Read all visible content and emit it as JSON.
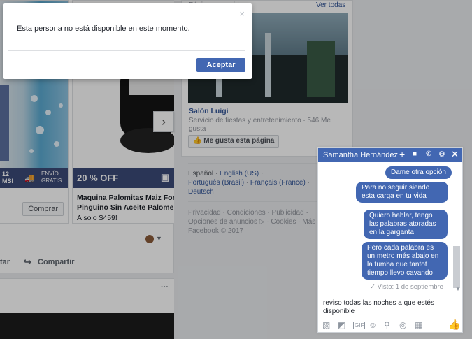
{
  "feed": {
    "products": [
      {
        "badge_left": "12",
        "badge_left_sub": "MSI",
        "badge_right": "ENVÍO",
        "badge_right_sub": "GRATIS",
        "buy_label": "Comprar"
      },
      {
        "discount": "20 % OFF",
        "title_line1": "Maquina Palomitas Maiz Forma",
        "title_line2": "Pingüino Sin Aceite Palomera",
        "price": "A solo $459!"
      }
    ],
    "comment_action": "tar",
    "share_action": "Compartir",
    "more": "···"
  },
  "suggested": {
    "title": "Páginas sugeridas",
    "see_all": "Ver todas",
    "page_name": "Salón Luigi",
    "page_desc_line1": "Servicio de fiestas y entretenimiento · 546 Me",
    "page_desc_line2": "gusta",
    "like_button": "Me gusta esta página"
  },
  "languages": {
    "line1": [
      "Español",
      "English (US)"
    ],
    "line2": [
      "Português (Brasil)",
      "Français (France)"
    ],
    "line3": [
      "Deutsch"
    ]
  },
  "footer": {
    "line1": [
      "Privacidad",
      "Condiciones",
      "Publicidad"
    ],
    "line2": [
      "Opciones de anuncios",
      "Cookies",
      "Más"
    ],
    "copyright": "Facebook © 2017"
  },
  "modal": {
    "message": "Esta persona no está disponible en este momento.",
    "accept_label": "Aceptar",
    "close": "×"
  },
  "chat": {
    "contact_name": "Samantha Hernández",
    "messages": [
      "Dame otra opción",
      "Para no seguir siendo esta carga en tu vida",
      "Quiero hablar, tengo las palabras atoradas en la garganta",
      "Pero cada palabra es un metro más abajo en la tumba que tantot tiempo llevo cavando"
    ],
    "seen": "Visto: 1 de septiembre",
    "draft": "reviso todas las noches a que estés disponible"
  },
  "colors": {
    "accent": "#4267b2",
    "band": "#3b4a78",
    "page_bg": "#e9ebee"
  }
}
